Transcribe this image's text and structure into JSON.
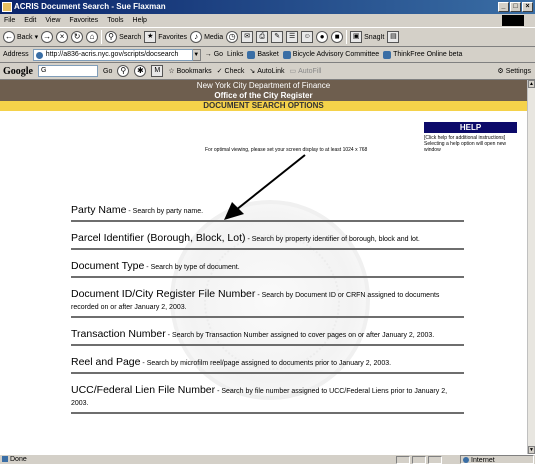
{
  "window": {
    "title": "ACRIS Document Search - Sue Flaxman",
    "min": "_",
    "max": "□",
    "close": "×"
  },
  "menu": [
    "File",
    "Edit",
    "View",
    "Favorites",
    "Tools",
    "Help"
  ],
  "toolbar": {
    "back": "Back",
    "search": "Search",
    "favorites": "Favorites",
    "media": "Media",
    "snagit": "SnagIt"
  },
  "address": {
    "label": "Address",
    "url": "http://a836-acris.nyc.gov/scripts/docsearch",
    "go": "Go",
    "links_label": "Links",
    "links": [
      "Basket",
      "Bicycle Advisory Committee",
      "ThinkFree Online beta"
    ]
  },
  "google": {
    "logo": "Google",
    "input": "G",
    "go": "Go",
    "bookmarks": "Bookmarks",
    "check": "Check",
    "autolink": "AutoLink",
    "autofill": "AutoFill",
    "settings": "Settings"
  },
  "page": {
    "banner_line1": "New York City Department of Finance",
    "banner_line2": "Office of the City Register",
    "section_title": "DOCUMENT SEARCH OPTIONS",
    "help_button": "HELP",
    "help_text": "[Click help for additional instructions] Selecting a help option will open new window",
    "optimal_note": "For optimal viewing, please set your screen display to at least 1024 x 768",
    "options": [
      {
        "title": "Party Name",
        "desc": " - Search by party name."
      },
      {
        "title": "Parcel Identifier (Borough, Block, Lot)",
        "desc": " - Search by property identifier of borough, block and lot."
      },
      {
        "title": "Document Type",
        "desc": " - Search by type of document."
      },
      {
        "title": "Document ID/City Register File Number",
        "desc": " - Search by Document ID or CRFN assigned to documents recorded on or after January 2, 2003."
      },
      {
        "title": "Transaction Number",
        "desc": " - Search by Transaction Number assigned to cover pages on or after January 2, 2003."
      },
      {
        "title": "Reel and Page",
        "desc": " - Search by microfilm reel/page assigned to documents prior to January 2, 2003."
      },
      {
        "title": "UCC/Federal Lien File Number",
        "desc": " - Search by file number assigned to UCC/Federal Liens prior to January 2, 2003."
      }
    ]
  },
  "status": {
    "left": "Done",
    "zone": "Internet"
  }
}
